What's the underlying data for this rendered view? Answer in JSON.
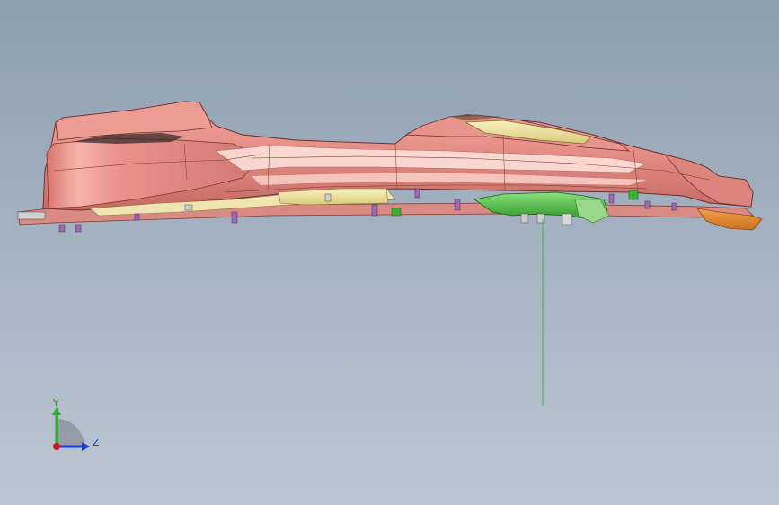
{
  "viewport": {
    "background_top": "#8d9db0",
    "background_bottom": "#bcc6d2"
  },
  "model": {
    "body_color": "#e58f86",
    "body_shade": "#c96d66",
    "highlight_color": "#ffe2dc",
    "trim_color": "#f3e6a6",
    "bracket_color": "#55c24a",
    "spoiler_color": "#e28a2e",
    "clip_color": "#9a6ab0"
  },
  "section_line": {
    "color": "#2ecc40"
  },
  "triad": {
    "y_label": "Y",
    "z_label": "Z",
    "y_color": "#2fae2f",
    "z_color": "#1f3fd0",
    "origin_color": "#d01818"
  }
}
